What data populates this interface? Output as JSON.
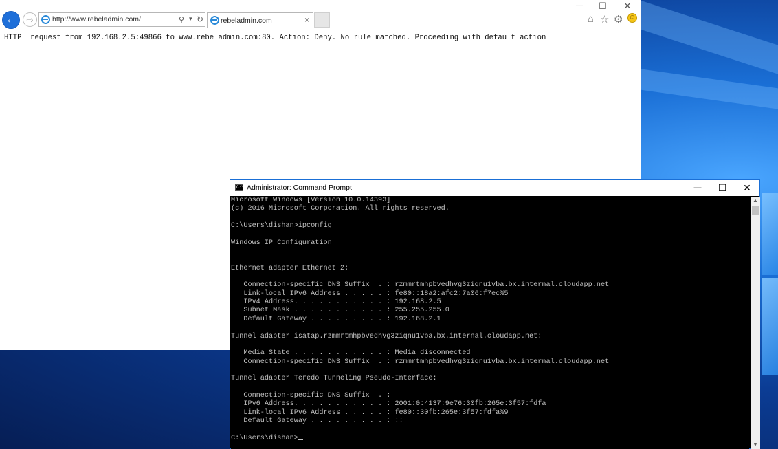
{
  "browser": {
    "url": "http://www.rebeladmin.com/",
    "tab_title": "rebeladmin.com",
    "back_glyph": "←",
    "forward_glyph": "⇨",
    "page_text": "HTTP  request from 192.168.2.5:49866 to www.rebeladmin.com:80. Action: Deny. No rule matched. Proceeding with default action",
    "controls": {
      "minimize": "—",
      "maximize": "☐",
      "close": "✕"
    },
    "toolbar_icons": [
      "home-icon",
      "favorites-icon",
      "settings-icon",
      "feedback-smiley-icon"
    ]
  },
  "cmd": {
    "title": "Administrator: Command Prompt",
    "icon_label": "C:\\",
    "controls": {
      "minimize": "—",
      "maximize": "☐",
      "close": "✕"
    },
    "lines": [
      "Microsoft Windows [Version 10.0.14393]",
      "(c) 2016 Microsoft Corporation. All rights reserved.",
      "",
      "C:\\Users\\dishan>ipconfig",
      "",
      "Windows IP Configuration",
      "",
      "",
      "Ethernet adapter Ethernet 2:",
      "",
      "   Connection-specific DNS Suffix  . : rzmmrtmhpbvedhvg3ziqnu1vba.bx.internal.cloudapp.net",
      "   Link-local IPv6 Address . . . . . : fe80::18a2:afc2:7a06:f7ec%5",
      "   IPv4 Address. . . . . . . . . . . : 192.168.2.5",
      "   Subnet Mask . . . . . . . . . . . : 255.255.255.0",
      "   Default Gateway . . . . . . . . . : 192.168.2.1",
      "",
      "Tunnel adapter isatap.rzmmrtmhpbvedhvg3ziqnu1vba.bx.internal.cloudapp.net:",
      "",
      "   Media State . . . . . . . . . . . : Media disconnected",
      "   Connection-specific DNS Suffix  . : rzmmrtmhpbvedhvg3ziqnu1vba.bx.internal.cloudapp.net",
      "",
      "Tunnel adapter Teredo Tunneling Pseudo-Interface:",
      "",
      "   Connection-specific DNS Suffix  . :",
      "   IPv6 Address. . . . . . . . . . . : 2001:0:4137:9e76:30fb:265e:3f57:fdfa",
      "   Link-local IPv6 Address . . . . . : fe80::30fb:265e:3f57:fdfa%9",
      "   Default Gateway . . . . . . . . . : ::",
      "",
      "C:\\Users\\dishan>"
    ]
  },
  "colors": {
    "console_bg": "#000000",
    "console_text": "#c0c0c0",
    "ie_blue": "#1e6fd9",
    "desktop_blue": "#0b3c94"
  }
}
